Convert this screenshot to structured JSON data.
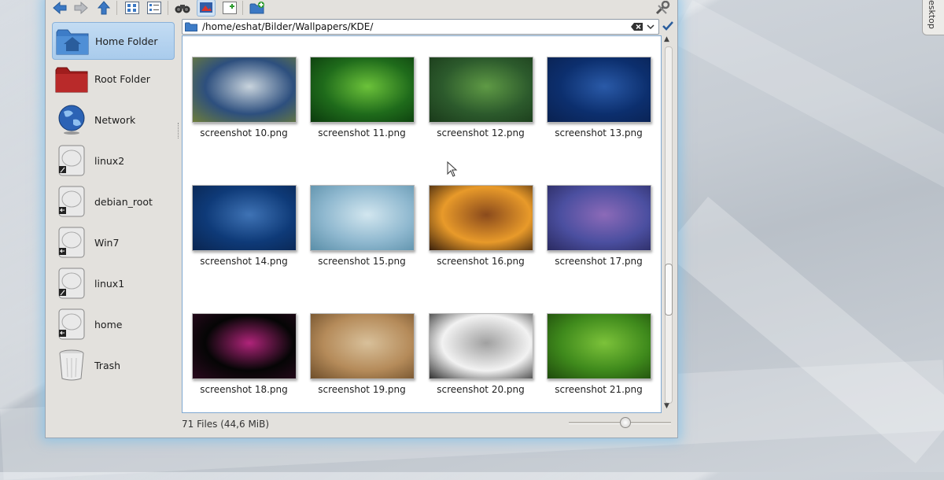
{
  "location": {
    "path": "/home/eshat/Bilder/Wallpapers/KDE/"
  },
  "toolbar": {
    "buttons": [
      {
        "name": "back-arrow-icon"
      },
      {
        "name": "forward-arrow-icon"
      },
      {
        "name": "up-arrow-icon"
      },
      {
        "name": "icon-view-icon"
      },
      {
        "name": "detail-view-icon"
      },
      {
        "name": "binoculars-icon"
      },
      {
        "name": "preview-icon"
      },
      {
        "name": "new-tab-icon"
      },
      {
        "name": "new-folder-icon"
      },
      {
        "name": "configure-icon"
      }
    ]
  },
  "places": [
    {
      "label": "Home Folder",
      "icon": "home-folder-icon",
      "selected": true
    },
    {
      "label": "Root Folder",
      "icon": "root-folder-icon"
    },
    {
      "label": "Network",
      "icon": "network-globe-icon"
    },
    {
      "label": "linux2",
      "icon": "harddisk-icon"
    },
    {
      "label": "debian_root",
      "icon": "harddisk-icon"
    },
    {
      "label": "Win7",
      "icon": "harddisk-icon"
    },
    {
      "label": "linux1",
      "icon": "harddisk-icon"
    },
    {
      "label": "home",
      "icon": "harddisk-icon"
    },
    {
      "label": "Trash",
      "icon": "trash-icon"
    }
  ],
  "files": [
    {
      "name": "screenshot 10.png",
      "colors": [
        "#2d4f7e",
        "#c9d4dd",
        "#6d7d3a"
      ]
    },
    {
      "name": "screenshot 11.png",
      "colors": [
        "#1f6b1b",
        "#6cc23a",
        "#0b3a0d"
      ]
    },
    {
      "name": "screenshot 12.png",
      "colors": [
        "#2c5a2c",
        "#5f9a45",
        "#1a3a1a"
      ]
    },
    {
      "name": "screenshot 13.png",
      "colors": [
        "#0c2f6e",
        "#2a5aa8",
        "#0a2150"
      ]
    },
    {
      "name": "screenshot 14.png",
      "colors": [
        "#0e3a78",
        "#3f73b5",
        "#0a2550"
      ]
    },
    {
      "name": "screenshot 15.png",
      "colors": [
        "#8fb8cf",
        "#d2e6ef",
        "#5a8ea8"
      ]
    },
    {
      "name": "screenshot 16.png",
      "colors": [
        "#e89a2a",
        "#8a4a1c",
        "#3a200c"
      ]
    },
    {
      "name": "screenshot 17.png",
      "colors": [
        "#4b4fa0",
        "#8c6ab8",
        "#2a2a60"
      ]
    },
    {
      "name": "screenshot 18.png",
      "colors": [
        "#050505",
        "#b0247a",
        "#2a0a1e"
      ]
    },
    {
      "name": "screenshot 19.png",
      "colors": [
        "#b58b5a",
        "#d8c09a",
        "#6e4e2a"
      ]
    },
    {
      "name": "screenshot 20.png",
      "colors": [
        "#f2f2f2",
        "#a0a0a0",
        "#303030"
      ]
    },
    {
      "name": "screenshot 21.png",
      "colors": [
        "#3f8a1c",
        "#7cc23a",
        "#1e4a0c"
      ]
    }
  ],
  "status": {
    "summary": "71 Files (44,6 MiB)",
    "zoom_level": 0.55
  },
  "desktop_tab": {
    "label": "esktop"
  },
  "colors": {
    "selection": "#a9cbec",
    "view_border": "#7fa8d0",
    "glow": "#78bee9"
  }
}
